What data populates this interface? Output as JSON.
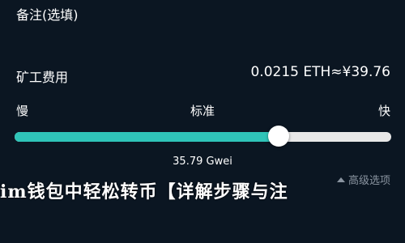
{
  "remark": {
    "label": "备注(选填)"
  },
  "fee": {
    "label": "矿工费用",
    "value": "0.0215 ETH≈¥39.76"
  },
  "speed": {
    "slow_label": "慢",
    "standard_label": "标准",
    "fast_label": "快",
    "level_fraction": 0.7,
    "gwei_text": "35.79 Gwei"
  },
  "advanced": {
    "label": "高级选项"
  },
  "banner": {
    "text": "im钱包中轻松转币【详解步骤与注"
  },
  "colors": {
    "background": "#0b1622",
    "slider_fill": "#2fc4b8",
    "slider_track": "#e8e8e8"
  }
}
